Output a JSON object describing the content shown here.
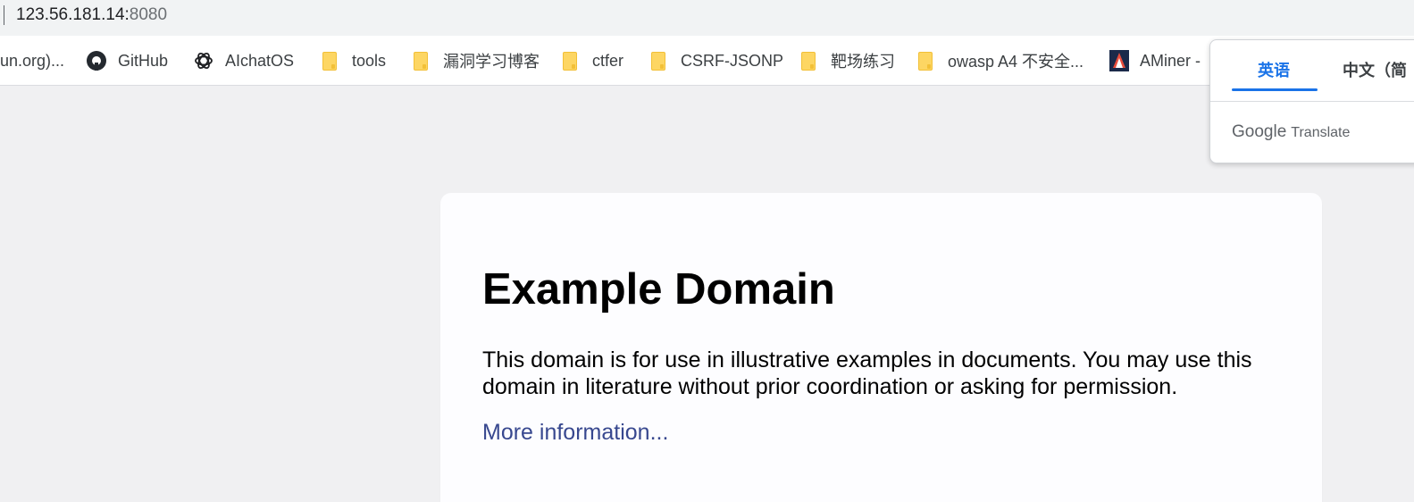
{
  "address_bar": {
    "host": "123.56.181.14:",
    "port": "8080"
  },
  "bookmarks": [
    {
      "label": "un.org)...",
      "icon": "none"
    },
    {
      "label": "GitHub",
      "icon": "github-icon"
    },
    {
      "label": "AIchatOS",
      "icon": "openai-icon"
    },
    {
      "label": "tools",
      "icon": "folder-icon"
    },
    {
      "label": "漏洞学习博客",
      "icon": "folder-icon"
    },
    {
      "label": "ctfer",
      "icon": "folder-icon"
    },
    {
      "label": "CSRF-JSONP",
      "icon": "folder-icon"
    },
    {
      "label": "靶场练习",
      "icon": "folder-icon"
    },
    {
      "label": "owasp A4 不安全...",
      "icon": "folder-icon"
    },
    {
      "label": "AMiner -",
      "icon": "aminer-icon"
    }
  ],
  "translate_popup": {
    "tab_source": "英语",
    "tab_target": "中文（简",
    "brand_google": "Google",
    "brand_translate": "Translate",
    "accent_color": "#1a73e8"
  },
  "page": {
    "title": "Example Domain",
    "body": "This domain is for use in illustrative examples in documents. You may use this domain in literature without prior coordination or asking for permission.",
    "link": "More information..."
  }
}
